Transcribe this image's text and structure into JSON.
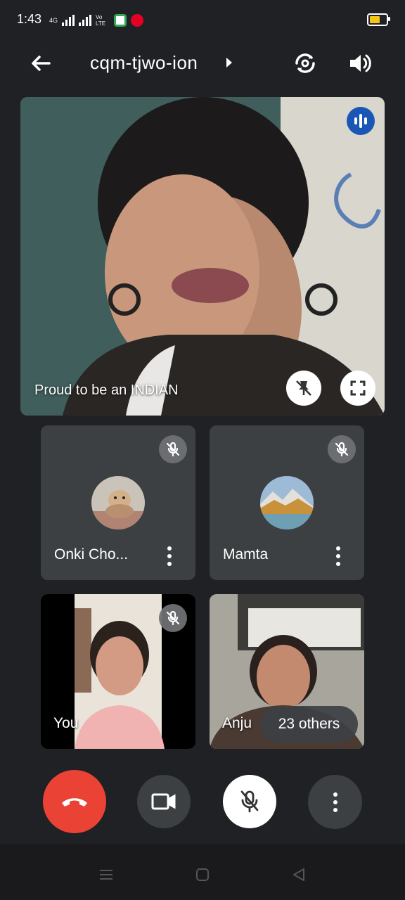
{
  "status_bar": {
    "time": "1:43",
    "network_label": "4G",
    "volte_label": "Vo LTE",
    "battery_color": "#f5c518"
  },
  "header": {
    "meeting_code": "cqm-tjwo-ion",
    "back_icon": "arrow-left-icon",
    "switch_camera_icon": "switch-camera-icon",
    "speaker_icon": "speaker-icon"
  },
  "main_tile": {
    "participant_name": "Proud to be an INDIAN",
    "speaking_indicator_color": "#1a56b5"
  },
  "participants": [
    {
      "name": "Onki Cho...",
      "muted": true
    },
    {
      "name": "Mamta",
      "muted": true
    },
    {
      "name": "You",
      "muted": true
    },
    {
      "name": "Anju",
      "muted": false
    }
  ],
  "others_pill": "23 others",
  "controls": {
    "end_call_color": "#ea4335",
    "end_call_icon": "phone-hangup-icon",
    "camera_icon": "video-camera-icon",
    "mic_icon": "mic-off-icon",
    "more_icon": "more-vert-icon"
  }
}
